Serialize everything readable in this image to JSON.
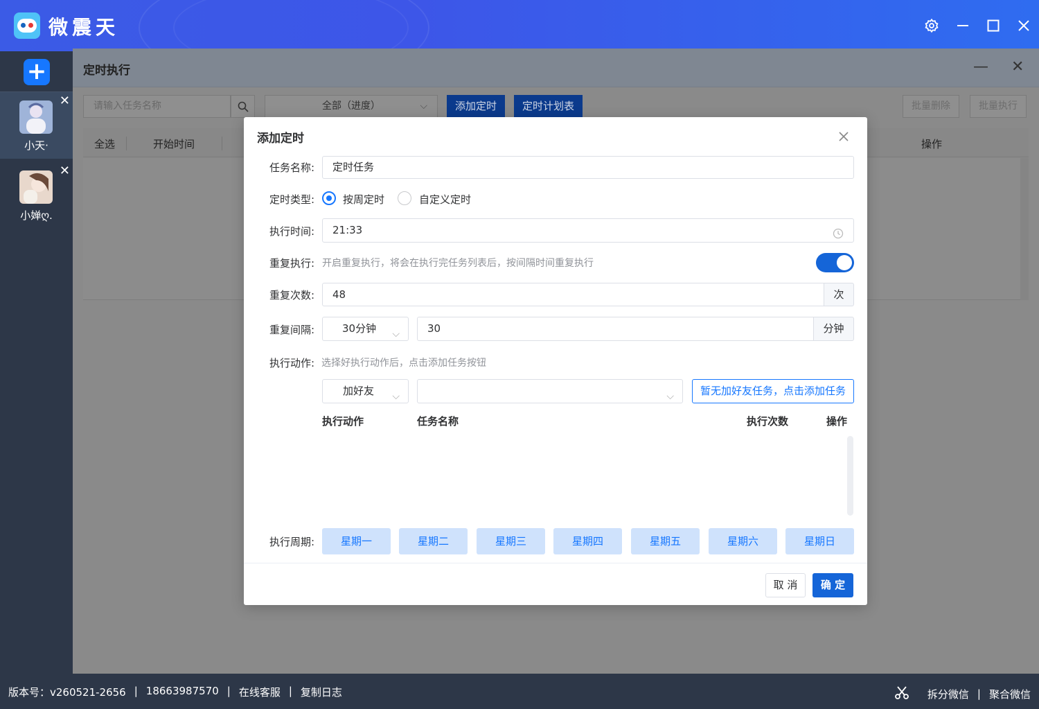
{
  "app": {
    "title": "微震天"
  },
  "sidebar": {
    "accounts": [
      {
        "name": "小天·"
      },
      {
        "name": "小婵ღ."
      }
    ]
  },
  "main": {
    "title": "定时执行",
    "search_placeholder": "请输入任务名称",
    "filter_selected": "全部（进度）",
    "add_timer_label": "添加定时",
    "schedule_label": "定时计划表",
    "batch_delete_label": "批量删除",
    "batch_execute_label": "批量执行",
    "columns": [
      "全选",
      "开始时间",
      "操作"
    ]
  },
  "dialog": {
    "title": "添加定时",
    "task_name_label": "任务名称:",
    "task_name_value": "定时任务",
    "timer_type_label": "定时类型:",
    "timer_type_options": [
      "按周定时",
      "自定义定时"
    ],
    "timer_type_selected": "按周定时",
    "exec_time_label": "执行时间:",
    "exec_time_value": "21:33",
    "repeat_label": "重复执行:",
    "repeat_hint": "开启重复执行，将会在执行完任务列表后，按间隔时间重复执行",
    "repeat_enabled": true,
    "repeat_count_label": "重复次数:",
    "repeat_count_value": "48",
    "repeat_count_unit": "次",
    "repeat_interval_label": "重复间隔:",
    "repeat_interval_select": "30分钟",
    "repeat_interval_value": "30",
    "repeat_interval_unit": "分钟",
    "action_label": "执行动作:",
    "action_hint": "选择好执行动作后，点击添加任务按钮",
    "action_select": "加好友",
    "task_select_value": "",
    "add_task_button": "暂无加好友任务，点击添加任务",
    "table_columns": [
      "执行动作",
      "任务名称",
      "执行次数",
      "操作"
    ],
    "period_label": "执行周期:",
    "weekdays": [
      "星期一",
      "星期二",
      "星期三",
      "星期四",
      "星期五",
      "星期六",
      "星期日"
    ],
    "cancel_label": "取 消",
    "ok_label": "确 定"
  },
  "statusbar": {
    "version": "版本号：v260521-2656",
    "phone": "18663987570",
    "support": "在线客服",
    "copy_log": "复制日志",
    "split": "拆分微信",
    "merge": "聚合微信",
    "separator": "|"
  },
  "colors": {
    "accent": "#1677ff",
    "sidebar": "#2d3748",
    "titlebar": "#3b5be6"
  }
}
